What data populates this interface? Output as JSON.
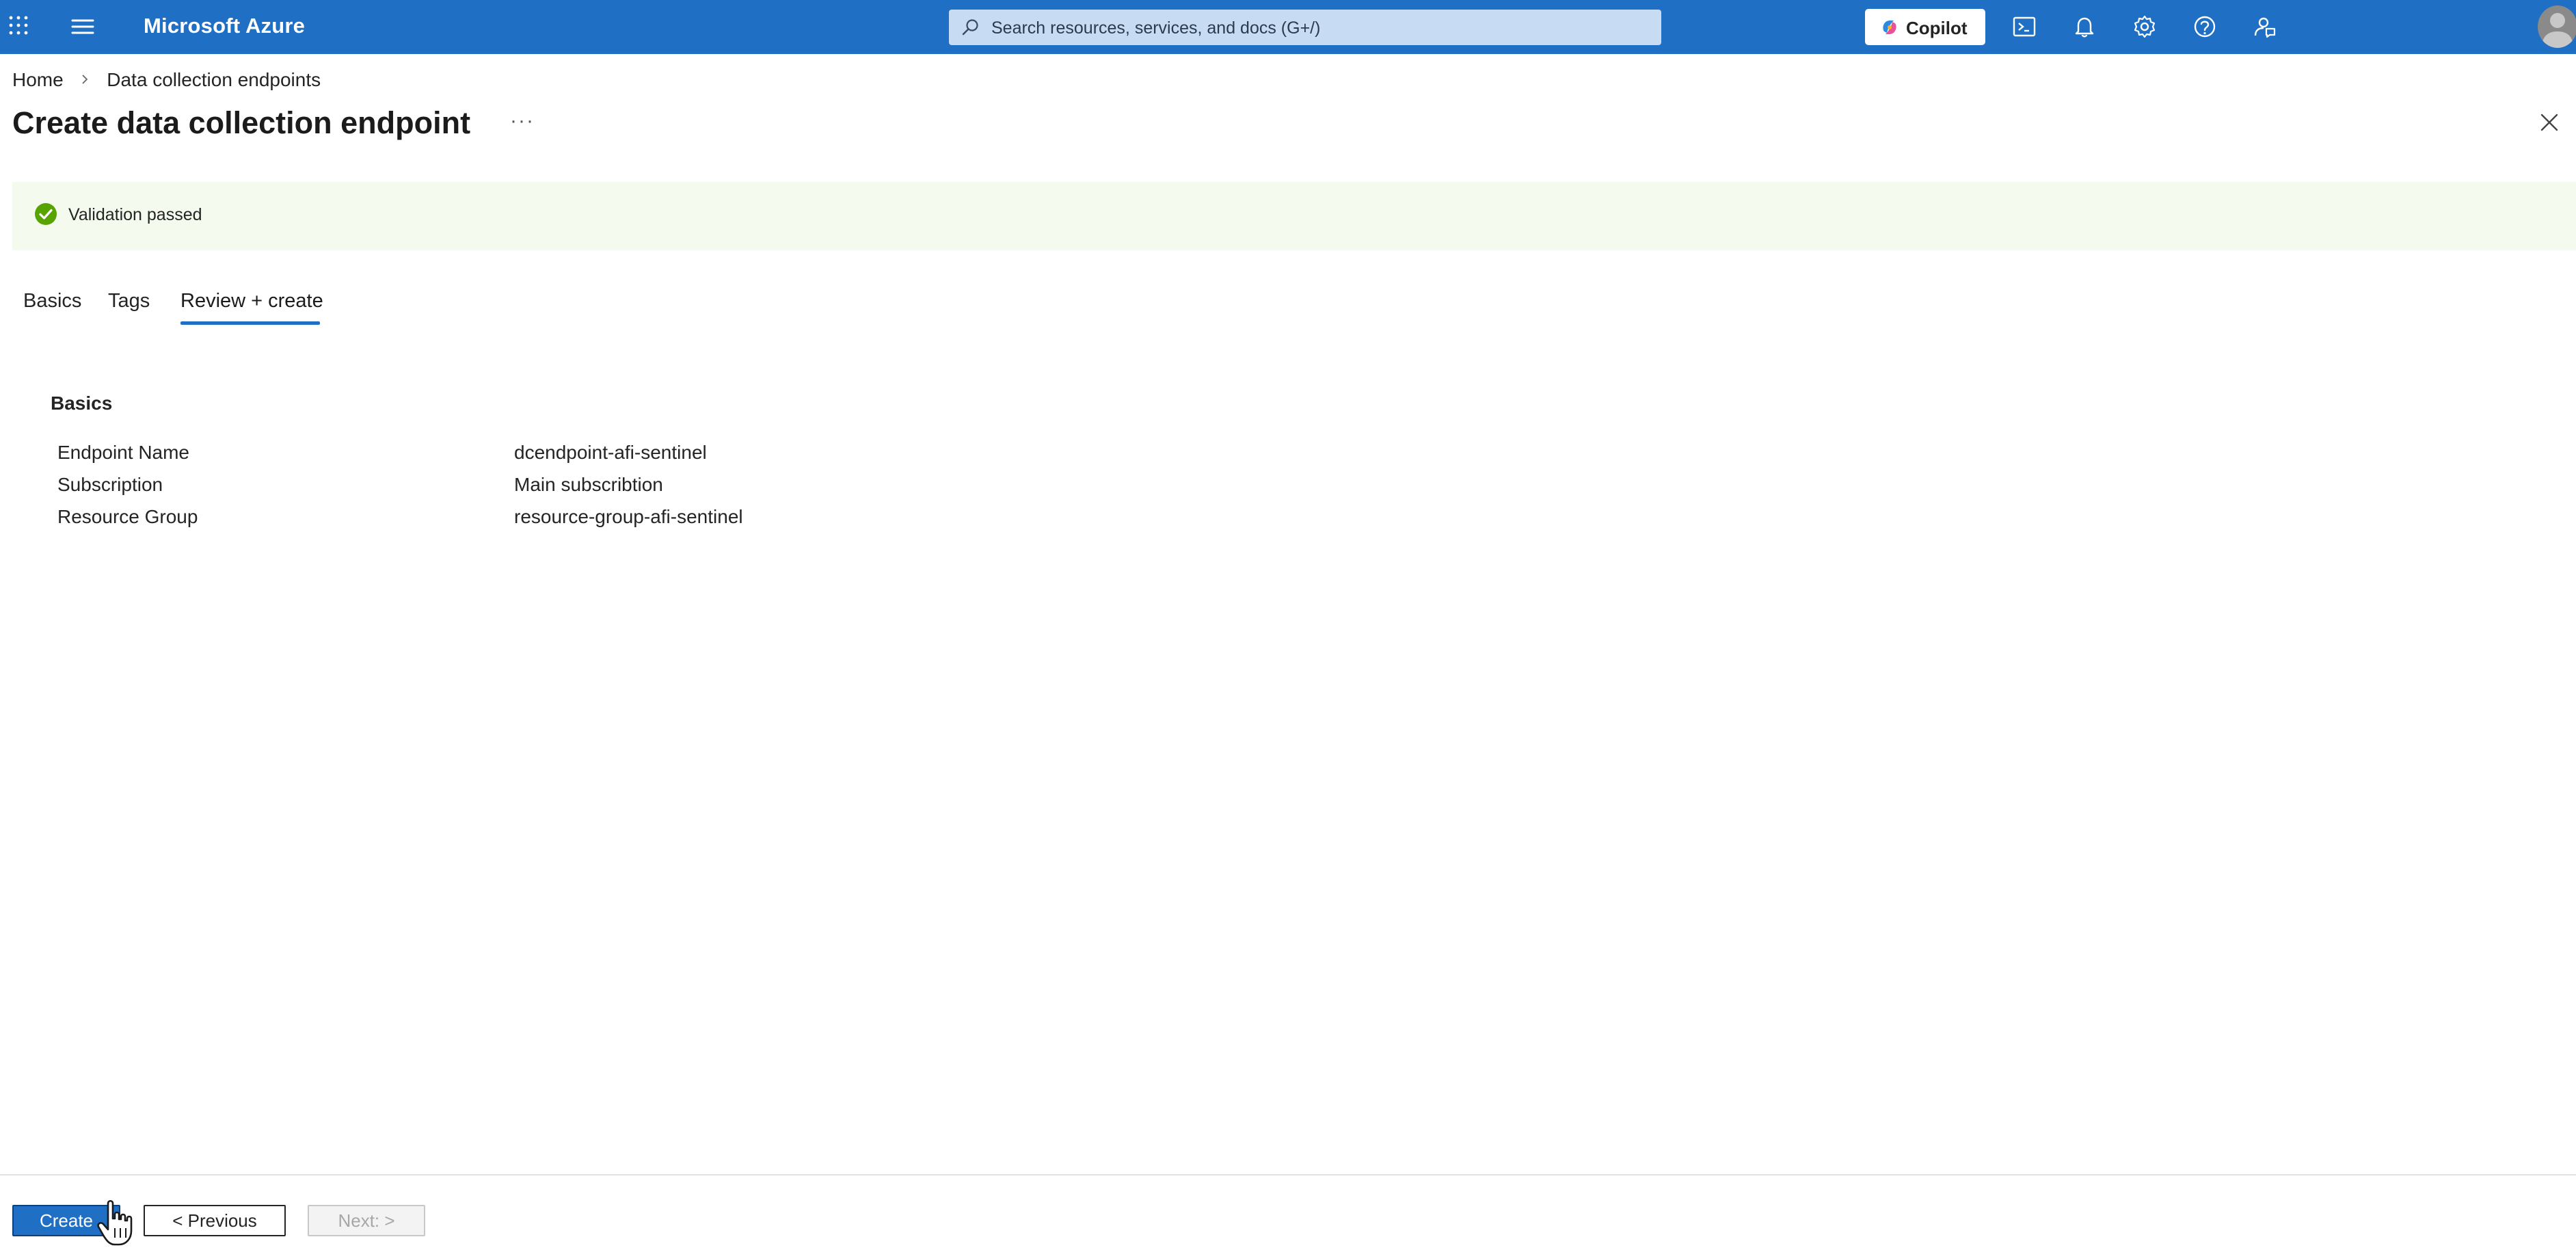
{
  "topbar": {
    "brand": "Microsoft Azure",
    "search_placeholder": "Search resources, services, and docs (G+/)",
    "copilot_label": "Copilot",
    "icons": [
      "waffle-icon",
      "hamburger-icon",
      "search-icon",
      "copilot-icon",
      "cloud-shell-icon",
      "bell-icon",
      "gear-icon",
      "help-icon",
      "feedback-icon",
      "avatar"
    ]
  },
  "breadcrumb": {
    "items": [
      "Home",
      "Data collection endpoints"
    ]
  },
  "page": {
    "title": "Create data collection endpoint",
    "more": "···"
  },
  "banner": {
    "text": "Validation passed"
  },
  "tabs": [
    {
      "label": "Basics",
      "active": false
    },
    {
      "label": "Tags",
      "active": false
    },
    {
      "label": "Review + create",
      "active": true
    }
  ],
  "section": {
    "title": "Basics",
    "rows": [
      {
        "key": "Endpoint Name",
        "value": "dcendpoint-afi-sentinel"
      },
      {
        "key": "Subscription",
        "value": "Main subscribtion"
      },
      {
        "key": "Resource Group",
        "value": "resource-group-afi-sentinel"
      }
    ]
  },
  "footer": {
    "create_label": "Create",
    "previous_label": "< Previous",
    "next_label": "Next: >"
  },
  "colors": {
    "topbar": "#1f6fc5",
    "accent": "#1f6fc5",
    "banner_bg": "#f4fbee",
    "success": "#57a300"
  }
}
